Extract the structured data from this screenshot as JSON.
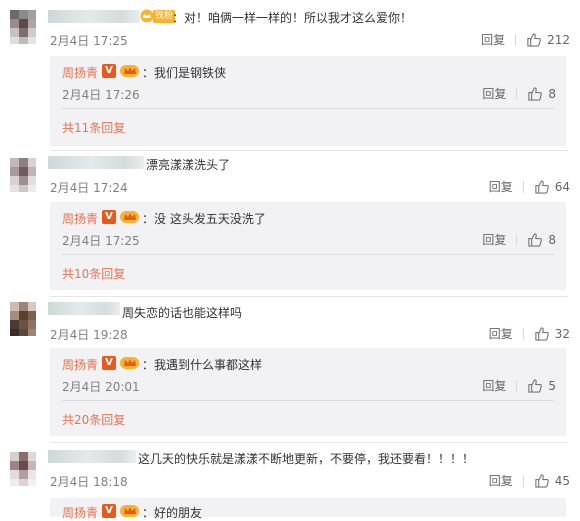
{
  "ui": {
    "reply_label": "回复",
    "reply_sep": "：",
    "fan_badge": "铁粉"
  },
  "comments": [
    {
      "text": "：对！咱俩一样一样的！所以我才这么爱你！",
      "time": "2月4日 17:25",
      "likes": "212",
      "reply": {
        "name": "周扬青",
        "text": "：我们是钢铁侠",
        "time": "2月4日 17:26",
        "likes": "8"
      },
      "more": "共11条回复"
    },
    {
      "text": "漂亮漾漾洗头了",
      "time": "2月4日 17:24",
      "likes": "64",
      "reply": {
        "name": "周扬青",
        "text": "：没 这头发五天没洗了",
        "time": "2月4日 17:25",
        "likes": "8"
      },
      "more": "共10条回复"
    },
    {
      "text": "周失恋的话也能这样吗",
      "time": "2月4日 19:28",
      "likes": "32",
      "reply": {
        "name": "周扬青",
        "text": "：我遇到什么事都这样",
        "time": "2月4日 20:01",
        "likes": "5"
      },
      "more": "共20条回复"
    },
    {
      "text": "这几天的快乐就是漾漾不断地更新，不要停，我还要看！！！！",
      "time": "2月4日 18:18",
      "likes": "45",
      "reply": {
        "name": "周扬青",
        "text": "：好的朋友"
      }
    }
  ],
  "colors": {
    "accent": "#eb7350",
    "time": "#808080",
    "reply_bg": "#f2f2f5"
  },
  "icons": [
    "thumbs-up-icon",
    "verified-v-icon",
    "vip-crown-icon",
    "avatar-mosaic"
  ]
}
